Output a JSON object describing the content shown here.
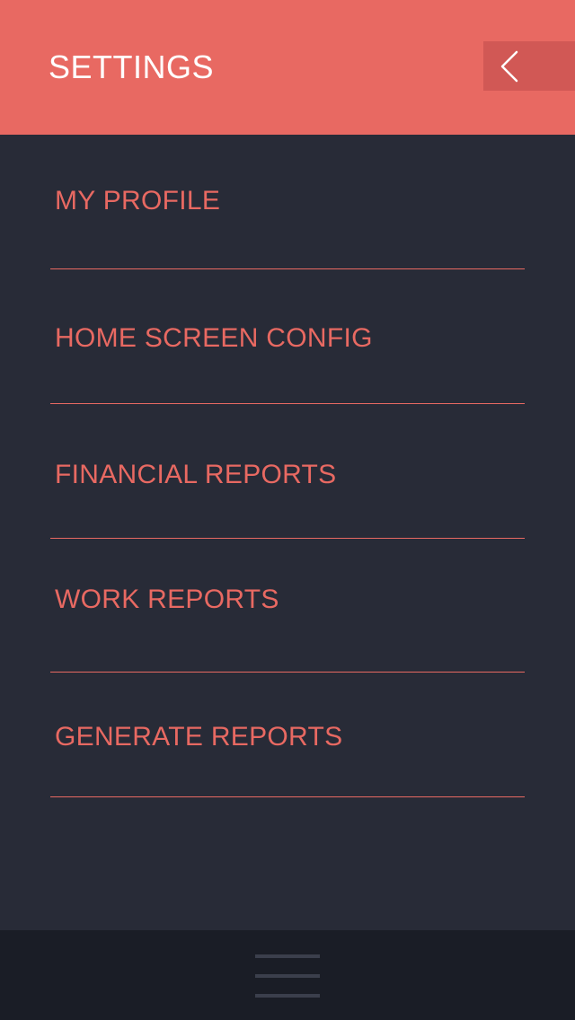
{
  "header": {
    "title": "SETTINGS",
    "back_icon": "chevron-left-icon"
  },
  "menu": {
    "items": [
      {
        "label": "MY PROFILE"
      },
      {
        "label": "HOME SCREEN CONFIG"
      },
      {
        "label": "FINANCIAL REPORTS"
      },
      {
        "label": "WORK REPORTS"
      },
      {
        "label": "GENERATE REPORTS"
      }
    ]
  },
  "footer": {
    "menu_icon": "hamburger-menu-icon"
  },
  "colors": {
    "accent": "#e86962",
    "accent_dark": "#d15855",
    "background": "#282b37",
    "footer": "#1a1d26",
    "icon_gray": "#3b3f4c",
    "header_text": "#ffffff"
  }
}
